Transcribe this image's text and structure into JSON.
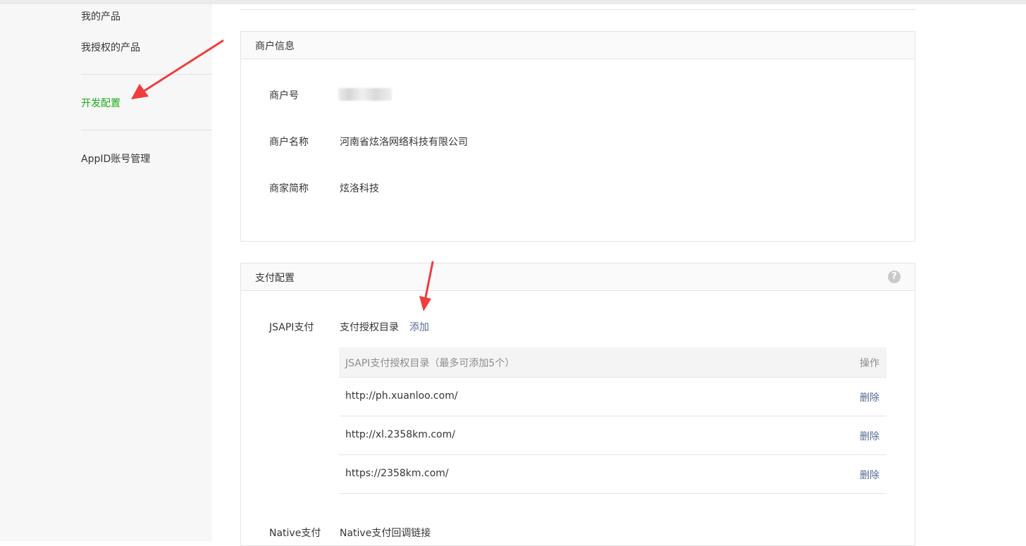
{
  "sidebar": {
    "items": [
      {
        "label": "我的产品"
      },
      {
        "label": "我授权的产品"
      },
      {
        "label": "开发配置"
      },
      {
        "label": "AppID账号管理"
      }
    ],
    "active_color": "#1aad19"
  },
  "merchant_panel": {
    "title": "商户信息",
    "fields": [
      {
        "label": "商户号",
        "value": ""
      },
      {
        "label": "商户名称",
        "value": "河南省炫洛网络科技有限公司"
      },
      {
        "label": "商家简称",
        "value": "炫洛科技"
      }
    ]
  },
  "payment_panel": {
    "title": "支付配置",
    "help_icon": "question-circle-icon",
    "jsapi": {
      "label": "JSAPI支付",
      "sub_label": "支付授权目录",
      "add_label": "添加",
      "table": {
        "col_directory": "JSAPI支付授权目录（最多可添加5个）",
        "col_action": "操作",
        "rows": [
          {
            "url": "http://ph.xuanloo.com/",
            "action": "删除"
          },
          {
            "url": "http://xl.2358km.com/",
            "action": "删除"
          },
          {
            "url": "https://2358km.com/",
            "action": "删除"
          }
        ]
      }
    },
    "native": {
      "label": "Native支付",
      "sub_label": "Native支付回调链接"
    }
  },
  "colors": {
    "link": "#576b95",
    "annotation_arrow": "#f03c3c"
  }
}
